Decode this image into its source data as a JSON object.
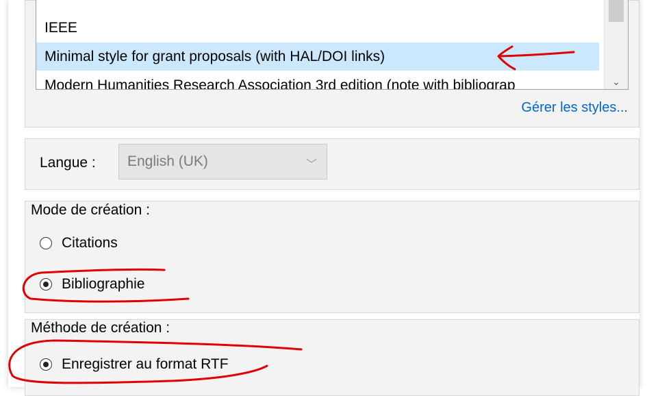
{
  "style_list": {
    "items": [
      "IEEE",
      "Minimal style for grant proposals (with HAL/DOI links)",
      "Modern Humanities Research Association 3rd edition (note with bibliograp"
    ],
    "selected_index": 1
  },
  "manage_styles_link": "Gérer les styles...",
  "language": {
    "label": "Langue :",
    "value": "English (UK)"
  },
  "creation_mode": {
    "title": "Mode de création :",
    "options": [
      "Citations",
      "Bibliographie"
    ],
    "selected": "Bibliographie"
  },
  "creation_method": {
    "title": "Méthode de création :",
    "options": [
      "Enregistrer au format RTF"
    ],
    "selected": "Enregistrer au format RTF"
  },
  "colors": {
    "selection": "#cce8ff",
    "link": "#0066cc",
    "annotation": "#e00000"
  }
}
